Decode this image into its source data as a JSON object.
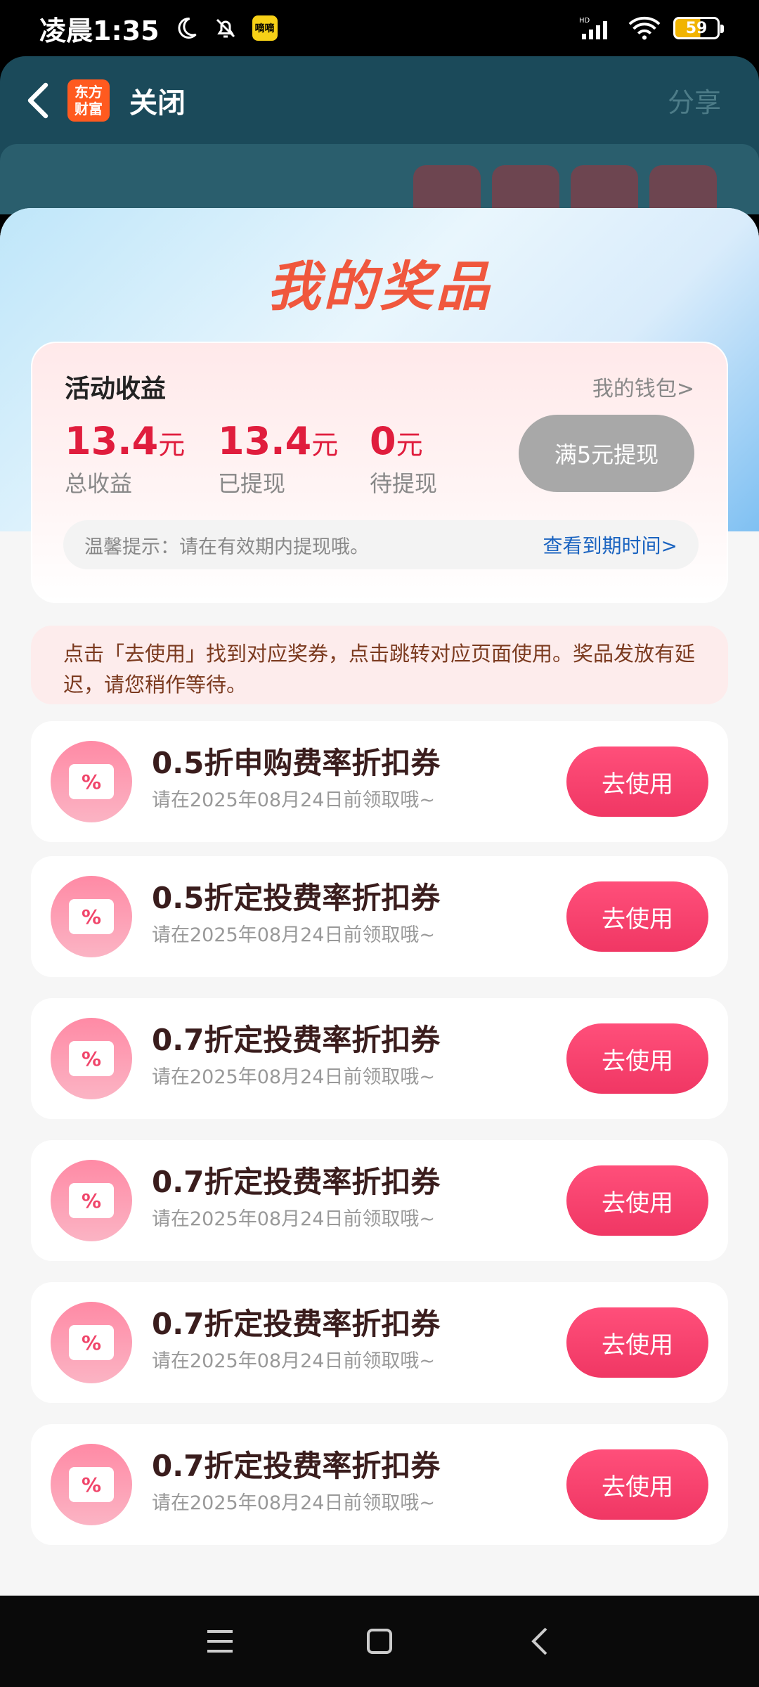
{
  "status_bar": {
    "time": "凌晨1:35",
    "mini_app_label": "嘀嘀",
    "battery": "59",
    "network": "HD"
  },
  "header": {
    "brand_line1": "东方",
    "brand_line2": "财富",
    "close_label": "关闭",
    "share_label": "分享"
  },
  "sheet": {
    "title": "我的奖品",
    "earnings": {
      "title": "活动收益",
      "wallet_link": "我的钱包>",
      "stats": [
        {
          "value": "13.4",
          "unit": "元",
          "label": "总收益"
        },
        {
          "value": "13.4",
          "unit": "元",
          "label": "已提现"
        },
        {
          "value": "0",
          "unit": "元",
          "label": "待提现"
        }
      ],
      "withdraw_button": "满5元提现",
      "tip": "温馨提示：请在有效期内提现哦。",
      "tip_link": "查看到期时间>"
    },
    "notice": "点击「去使用」找到对应奖券，点击跳转对应页面使用。奖品发放有延迟，请您稍作等待。",
    "coupons": [
      {
        "title": "0.5折申购费率折扣券",
        "subtitle": "请在2025年08月24日前领取哦~",
        "button": "去使用",
        "icon_text": "%"
      },
      {
        "title": "0.5折定投费率折扣券",
        "subtitle": "请在2025年08月24日前领取哦~",
        "button": "去使用",
        "icon_text": "%"
      },
      {
        "title": "0.7折定投费率折扣券",
        "subtitle": "请在2025年08月24日前领取哦~",
        "button": "去使用",
        "icon_text": "%"
      },
      {
        "title": "0.7折定投费率折扣券",
        "subtitle": "请在2025年08月24日前领取哦~",
        "button": "去使用",
        "icon_text": "%"
      },
      {
        "title": "0.7折定投费率折扣券",
        "subtitle": "请在2025年08月24日前领取哦~",
        "button": "去使用",
        "icon_text": "%"
      },
      {
        "title": "0.7折定投费率折扣券",
        "subtitle": "请在2025年08月24日前领取哦~",
        "button": "去使用",
        "icon_text": "%"
      }
    ]
  },
  "colors": {
    "accent": "#f03764",
    "amount": "#e01d3d",
    "link": "#1a63c0"
  }
}
